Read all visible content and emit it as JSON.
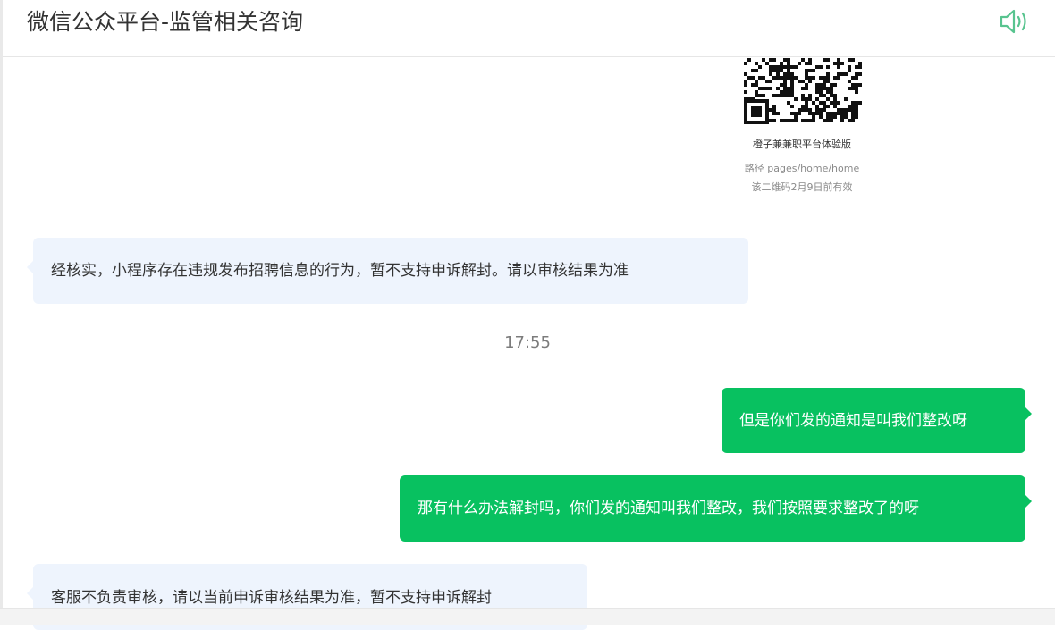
{
  "header": {
    "title": "微信公众平台-监管相关咨询",
    "speaker_icon": "speaker-icon"
  },
  "qr_card": {
    "name": "橙子兼兼职平台体验版",
    "path": "路径 pages/home/home",
    "validity": "该二维码2月9日前有效"
  },
  "messages": [
    {
      "side": "in",
      "text": "经核实，小程序存在违规发布招聘信息的行为，暂不支持申诉解封。请以审核结果为准"
    },
    {
      "side": "out",
      "text": "但是你们发的通知是叫我们整改呀"
    },
    {
      "side": "out",
      "text": "那有什么办法解封吗，你们发的通知叫我们整改，我们按照要求整改了的呀"
    },
    {
      "side": "in",
      "text": "客服不负责审核，请以当前申诉审核结果为准，暂不支持申诉解封"
    }
  ],
  "timestamp": "17:55",
  "colors": {
    "accent_green": "#08c160",
    "incoming_bubble": "#eef4fd",
    "speaker_icon": "#58c48f"
  }
}
